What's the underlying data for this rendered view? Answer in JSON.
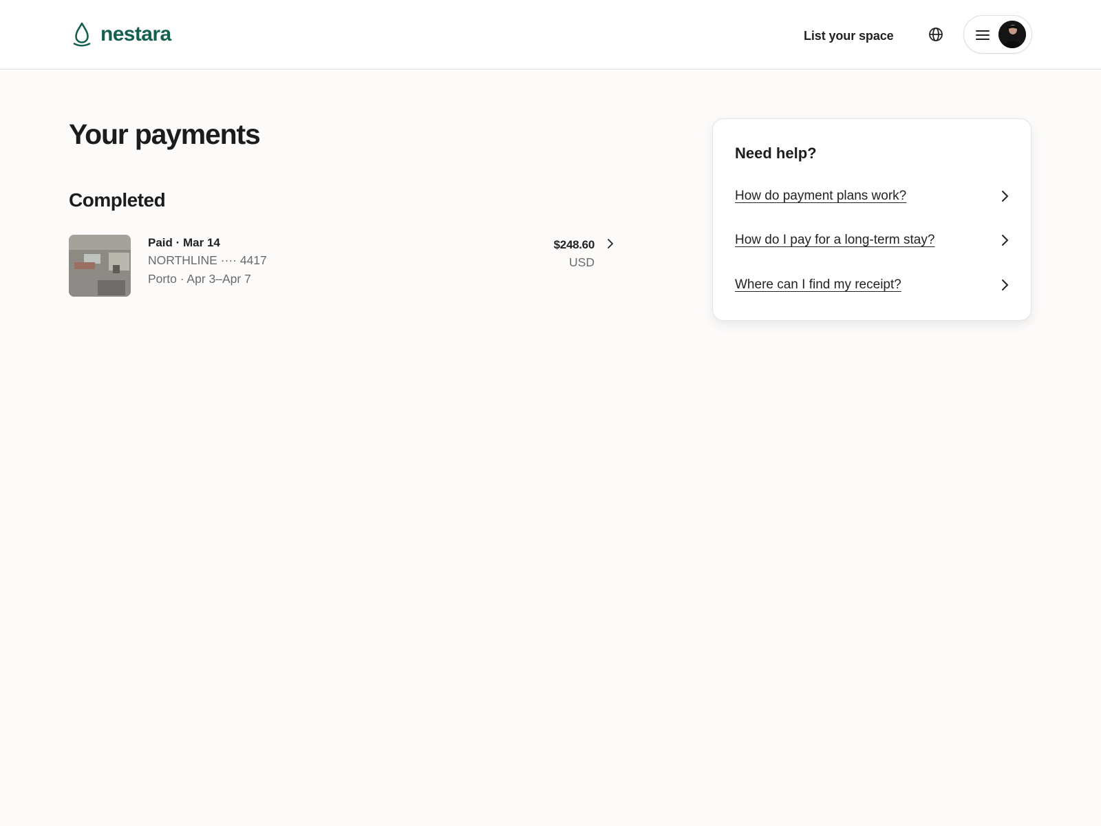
{
  "header": {
    "brand_name": "nestara",
    "host_link": "List your space",
    "icons": [
      "droplet-logo-icon",
      "globe-icon",
      "menu-icon",
      "avatar"
    ]
  },
  "page": {
    "title": "Your payments",
    "section_title": "Completed"
  },
  "payments": [
    {
      "status": "Paid · Mar 14",
      "card": "NORTHLINE ···· 4417",
      "stay": "Porto · Apr 3–Apr 7",
      "amount": "$248.60",
      "currency": "USD"
    }
  ],
  "help": {
    "title": "Need help?",
    "items": [
      "How do payment plans work?",
      "How do I pay for a long-term stay?",
      "Where can I find my receipt?"
    ]
  },
  "colors": {
    "brand": "#14604f",
    "text": "#222222",
    "muted": "#6a6a6a",
    "background": "#fcfbfa"
  }
}
